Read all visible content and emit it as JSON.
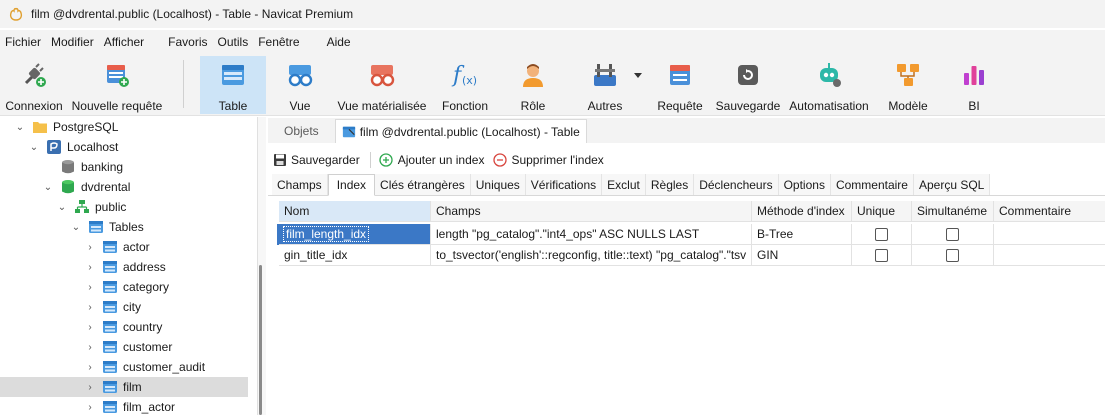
{
  "window": {
    "title": "film @dvdrental.public (Localhost) - Table - Navicat Premium"
  },
  "menu": [
    "Fichier",
    "Modifier",
    "Afficher",
    "Favoris",
    "Outils",
    "Fenêtre",
    "Aide"
  ],
  "toolbar": [
    {
      "label": "Connexion",
      "icon": "plug-connect-icon"
    },
    {
      "label": "Nouvelle requête",
      "icon": "new-query-icon"
    },
    {
      "label": "Table",
      "icon": "table-icon",
      "active": true
    },
    {
      "label": "Vue",
      "icon": "view-glasses-icon"
    },
    {
      "label": "Vue matérialisée",
      "icon": "materialized-view-icon"
    },
    {
      "label": "Fonction",
      "icon": "function-icon"
    },
    {
      "label": "Rôle",
      "icon": "user-role-icon"
    },
    {
      "label": "Autres",
      "icon": "tools-icon"
    },
    {
      "label": "Requête",
      "icon": "query-icon"
    },
    {
      "label": "Sauvegarde",
      "icon": "backup-icon"
    },
    {
      "label": "Automatisation",
      "icon": "robot-icon"
    },
    {
      "label": "Modèle",
      "icon": "model-icon"
    },
    {
      "label": "BI",
      "icon": "bi-chart-icon"
    }
  ],
  "sidebar": {
    "items": [
      {
        "label": "PostgreSQL",
        "level": 0,
        "expanded": true,
        "icon": "folder-icon"
      },
      {
        "label": "Localhost",
        "level": 1,
        "expanded": true,
        "icon": "postgresql-server-icon"
      },
      {
        "label": "banking",
        "level": 2,
        "expanded": false,
        "icon": "database-gray-icon"
      },
      {
        "label": "dvdrental",
        "level": 2,
        "expanded": true,
        "icon": "database-green-icon"
      },
      {
        "label": "public",
        "level": 3,
        "expanded": true,
        "icon": "schema-icon"
      },
      {
        "label": "Tables",
        "level": 4,
        "expanded": true,
        "icon": "tables-folder-icon"
      },
      {
        "label": "actor",
        "level": 5,
        "icon": "table-icon"
      },
      {
        "label": "address",
        "level": 5,
        "icon": "table-icon"
      },
      {
        "label": "category",
        "level": 5,
        "icon": "table-icon"
      },
      {
        "label": "city",
        "level": 5,
        "icon": "table-icon"
      },
      {
        "label": "country",
        "level": 5,
        "icon": "table-icon"
      },
      {
        "label": "customer",
        "level": 5,
        "icon": "table-icon"
      },
      {
        "label": "customer_audit",
        "level": 5,
        "icon": "table-icon"
      },
      {
        "label": "film",
        "level": 5,
        "icon": "table-icon",
        "selected": true
      },
      {
        "label": "film_actor",
        "level": 5,
        "icon": "table-icon"
      }
    ]
  },
  "doc_tabs": [
    {
      "label": "Objets",
      "active": false
    },
    {
      "label": "film @dvdrental.public (Localhost) - Table",
      "active": true
    }
  ],
  "actions": {
    "save": "Sauvegarder",
    "add_index": "Ajouter un index",
    "remove_index": "Supprimer l'index"
  },
  "subtabs": [
    "Champs",
    "Index",
    "Clés étrangères",
    "Uniques",
    "Vérifications",
    "Exclut",
    "Règles",
    "Déclencheurs",
    "Options",
    "Commentaire",
    "Aperçu SQL"
  ],
  "active_subtab": "Index",
  "grid": {
    "columns": [
      "Nom",
      "Champs",
      "Méthode d'index",
      "Unique",
      "Simultanéme",
      "Commentaire"
    ],
    "rows": [
      {
        "name": "film_length_idx",
        "fields": "length \"pg_catalog\".\"int4_ops\" ASC NULLS LAST",
        "method": "B-Tree",
        "unique": false,
        "concurrent": false,
        "comment": ""
      },
      {
        "name": "gin_title_idx",
        "fields": "to_tsvector('english'::regconfig, title::text) \"pg_catalog\".\"tsv",
        "method": "GIN",
        "unique": false,
        "concurrent": false,
        "comment": ""
      }
    ]
  },
  "colors": {
    "accent": "#3b78c6",
    "active_tool": "#cde4f7",
    "sidebar_selected": "#dcdcdc"
  }
}
